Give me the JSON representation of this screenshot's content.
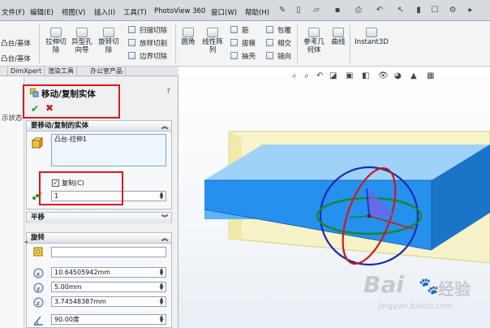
{
  "menu": {
    "items": [
      "文件(F)",
      "编辑(E)",
      "视图(V)",
      "插入(I)",
      "工具(T)",
      "PhotoView 360",
      "窗口(W)",
      "帮助(H)"
    ]
  },
  "ribbon": {
    "left_items": [
      "凸台/基体",
      "凸台/基体"
    ],
    "big_buttons": [
      "拉伸切除",
      "异型孔向导",
      "旋转切除"
    ],
    "small_buttons": [
      "扫描切除",
      "放样切割",
      "边界切除"
    ],
    "fillet": "圆角",
    "pattern": "线性阵列",
    "features": [
      "筋",
      "拔模",
      "抽壳",
      "包覆",
      "相交",
      "镜向"
    ],
    "refgeom": "参考几何体",
    "curves": "曲线",
    "instant3d": "Instant3D"
  },
  "tabs": [
    "DimXpert",
    "渲染工具",
    "办公室产品"
  ],
  "left_fragment": "示状态",
  "pm": {
    "title": "移动/复制实体",
    "help": "?",
    "ok": "✔",
    "cancel": "✖",
    "bodies_section": "要移动/复制的实体",
    "body_item": "凸台-拉伸1",
    "copy_label": "复制(C)",
    "copy_count": "1",
    "translate_section": "平移",
    "rotate_section": "旋转",
    "rotate_x": "10.64505942mm",
    "rotate_y": "5.00mm",
    "rotate_z": "3.74548387mm",
    "angle": "90.00度"
  },
  "watermark": {
    "brand": "Bai",
    "brand2": "经验",
    "url": "jingyan.baidu.com"
  },
  "colors": {
    "body": "#1f8ff0",
    "ring_red": "#d01818",
    "ring_green": "#168a28",
    "ring_blue": "#1a2ab8",
    "annotation": "#e0161c"
  }
}
